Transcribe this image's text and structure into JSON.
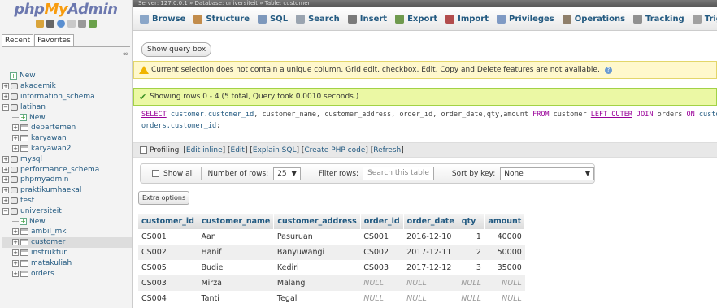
{
  "sidebar": {
    "logo": {
      "php": "php",
      "my": "My",
      "admin": "Admin"
    },
    "tabs": [
      "Recent",
      "Favorites"
    ],
    "tree": [
      {
        "label": "New",
        "type": "new",
        "level": 0
      },
      {
        "label": "akademik",
        "type": "db",
        "level": 0
      },
      {
        "label": "information_schema",
        "type": "db",
        "level": 0
      },
      {
        "label": "latihan",
        "type": "db",
        "level": 0,
        "expanded": true
      },
      {
        "label": "New",
        "type": "new",
        "level": 1
      },
      {
        "label": "departemen",
        "type": "table",
        "level": 1
      },
      {
        "label": "karyawan",
        "type": "table",
        "level": 1
      },
      {
        "label": "karyawan2",
        "type": "table",
        "level": 1
      },
      {
        "label": "mysql",
        "type": "db",
        "level": 0
      },
      {
        "label": "performance_schema",
        "type": "db",
        "level": 0
      },
      {
        "label": "phpmyadmin",
        "type": "db",
        "level": 0
      },
      {
        "label": "praktikumhaekal",
        "type": "db",
        "level": 0
      },
      {
        "label": "test",
        "type": "db",
        "level": 0
      },
      {
        "label": "universiteit",
        "type": "db",
        "level": 0,
        "expanded": true
      },
      {
        "label": "New",
        "type": "new",
        "level": 1
      },
      {
        "label": "ambil_mk",
        "type": "table",
        "level": 1
      },
      {
        "label": "customer",
        "type": "table",
        "level": 1,
        "selected": true
      },
      {
        "label": "instruktur",
        "type": "table",
        "level": 1
      },
      {
        "label": "matakuliah",
        "type": "table",
        "level": 1
      },
      {
        "label": "orders",
        "type": "table",
        "level": 1
      }
    ]
  },
  "breadcrumb": "Server: 127.0.0.1 » Database: universiteit » Table: customer",
  "tabs": [
    {
      "label": "Browse",
      "icon": "browse-icon",
      "color": "#8aa6c8"
    },
    {
      "label": "Structure",
      "icon": "structure-icon",
      "color": "#c28c4b"
    },
    {
      "label": "SQL",
      "icon": "sql-icon",
      "color": "#7d98bc"
    },
    {
      "label": "Search",
      "icon": "search-icon",
      "color": "#9aa4b0"
    },
    {
      "label": "Insert",
      "icon": "insert-icon",
      "color": "#7a7a7a"
    },
    {
      "label": "Export",
      "icon": "export-icon",
      "color": "#6f9a4e"
    },
    {
      "label": "Import",
      "icon": "import-icon",
      "color": "#b24c4c"
    },
    {
      "label": "Privileges",
      "icon": "privileges-icon",
      "color": "#7f9ac4"
    },
    {
      "label": "Operations",
      "icon": "operations-icon",
      "color": "#8f7f6a"
    },
    {
      "label": "Tracking",
      "icon": "tracking-icon",
      "color": "#909090"
    },
    {
      "label": "Triggers",
      "icon": "triggers-icon",
      "color": "#a0a0a0"
    }
  ],
  "show_query_label": "Show query box",
  "warning": "Current selection does not contain a unique column. Grid edit, checkbox, Edit, Copy and Delete features are not available.",
  "success": "Showing rows 0 - 4 (5 total, Query took 0.0010 seconds.)",
  "sql": {
    "select": "SELECT",
    "c1": "customer.customer_id",
    "rest1": ", customer_name, customer_address, order_id, order_date,qty,amount ",
    "from": "FROM",
    "t1": " customer ",
    "join": "LEFT OUTER",
    "join2": " JOIN",
    "t2": " orders ",
    "on": "ON",
    "c2": " customer.customer_id",
    "eq": " = ",
    "line2_col": "orders.customer_id",
    "line2_end": ";"
  },
  "profiling": {
    "label": "Profiling",
    "links": [
      "Edit inline",
      "Edit",
      "Explain SQL",
      "Create PHP code",
      "Refresh"
    ]
  },
  "nav": {
    "show_all": "Show all",
    "rows_label": "Number of rows:",
    "rows_value": "25",
    "filter_label": "Filter rows:",
    "filter_placeholder": "Search this table",
    "sort_label": "Sort by key:",
    "sort_value": "None"
  },
  "extra_options": "Extra options",
  "table": {
    "columns": [
      "customer_id",
      "customer_name",
      "customer_address",
      "order_id",
      "order_date",
      "qty",
      "amount"
    ],
    "rows": [
      [
        "CS001",
        "Aan",
        "Pasuruan",
        "CS001",
        "2016-12-10",
        "1",
        "40000"
      ],
      [
        "CS002",
        "Hanif",
        "Banyuwangi",
        "CS002",
        "2017-12-11",
        "2",
        "50000"
      ],
      [
        "CS005",
        "Budie",
        "Kediri",
        "CS003",
        "2017-12-12",
        "3",
        "35000"
      ],
      [
        "CS003",
        "Mirza",
        "Malang",
        "NULL",
        "NULL",
        "NULL",
        "NULL"
      ],
      [
        "CS004",
        "Tanti",
        "Tegal",
        "NULL",
        "NULL",
        "NULL",
        "NULL"
      ]
    ]
  }
}
